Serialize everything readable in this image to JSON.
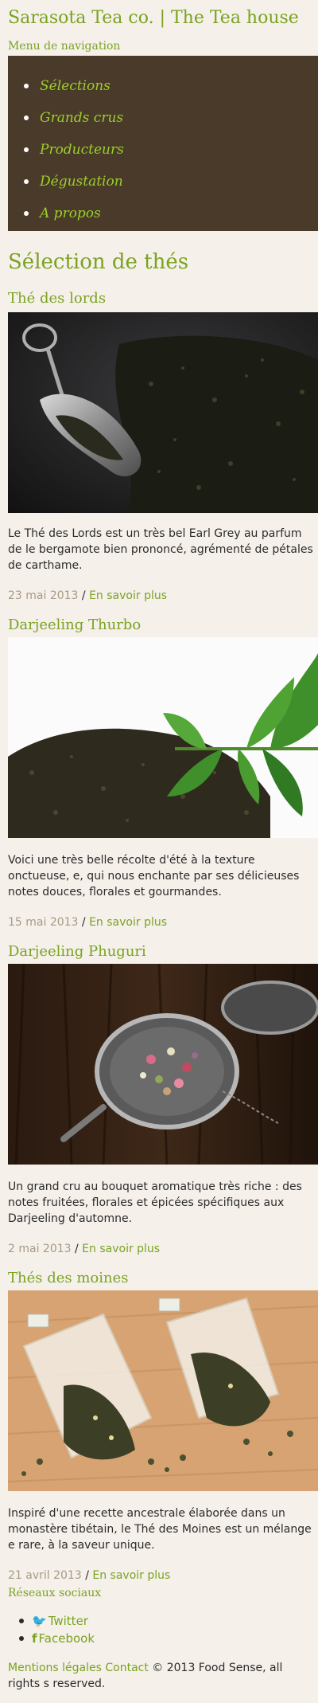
{
  "site": {
    "title": "Sarasota Tea co. | The Tea house"
  },
  "nav": {
    "heading": "Menu de navigation",
    "items": [
      {
        "label": "Sélections"
      },
      {
        "label": "Grands crus"
      },
      {
        "label": "Producteurs"
      },
      {
        "label": "Dégustation"
      },
      {
        "label": "A propos"
      }
    ]
  },
  "main": {
    "title": "Sélection de thés",
    "posts": [
      {
        "title": "Thé des lords",
        "image": "tea-scoop-photo",
        "text": "Le Thé des Lords est un très bel Earl Grey au parfum de le bergamote bien prononcé, agrémenté de pétales de carthame.",
        "date": "23 mai 2013",
        "separator": " / ",
        "link": "En savoir plus"
      },
      {
        "title": "Darjeeling Thurbo",
        "image": "tea-leaves-photo",
        "text": "Voici une très belle récolte d'été à la texture onctueuse, e, qui nous enchante par ses délicieuses notes douces, florales et gourmandes.",
        "date": "15 mai 2013",
        "separator": " / ",
        "link": "En savoir plus"
      },
      {
        "title": "Darjeeling Phuguri",
        "image": "tea-infuser-photo",
        "text": "Un grand cru au bouquet aromatique très riche : des notes fruitées, florales et épicées spécifiques aux Darjeeling d'automne.",
        "date": "2 mai 2013",
        "separator": " / ",
        "link": "En savoir plus"
      },
      {
        "title": "Thés des moines",
        "image": "tea-bags-photo",
        "text": "Inspiré d'une recette ancestrale élaborée dans un monastère tibétain, le Thé des Moines est un mélange e rare, à la saveur unique.",
        "date": "21 avril 2013",
        "separator": " / ",
        "link": "En savoir plus"
      }
    ]
  },
  "social": {
    "heading": "Réseaux sociaux",
    "items": [
      {
        "icon": "twitter-icon",
        "glyph": "🐦",
        "label": "Twitter"
      },
      {
        "icon": "facebook-icon",
        "glyph": "f",
        "label": "Facebook"
      }
    ]
  },
  "footer": {
    "legal": "Mentions légales",
    "contact": "Contact",
    "copyright": "© 2013 Food Sense, all rights s reserved."
  },
  "colors": {
    "accent": "#7aa321",
    "nav_background": "#4a3a2a",
    "page_background": "#f5f0ea",
    "date_text": "#a79a86"
  }
}
